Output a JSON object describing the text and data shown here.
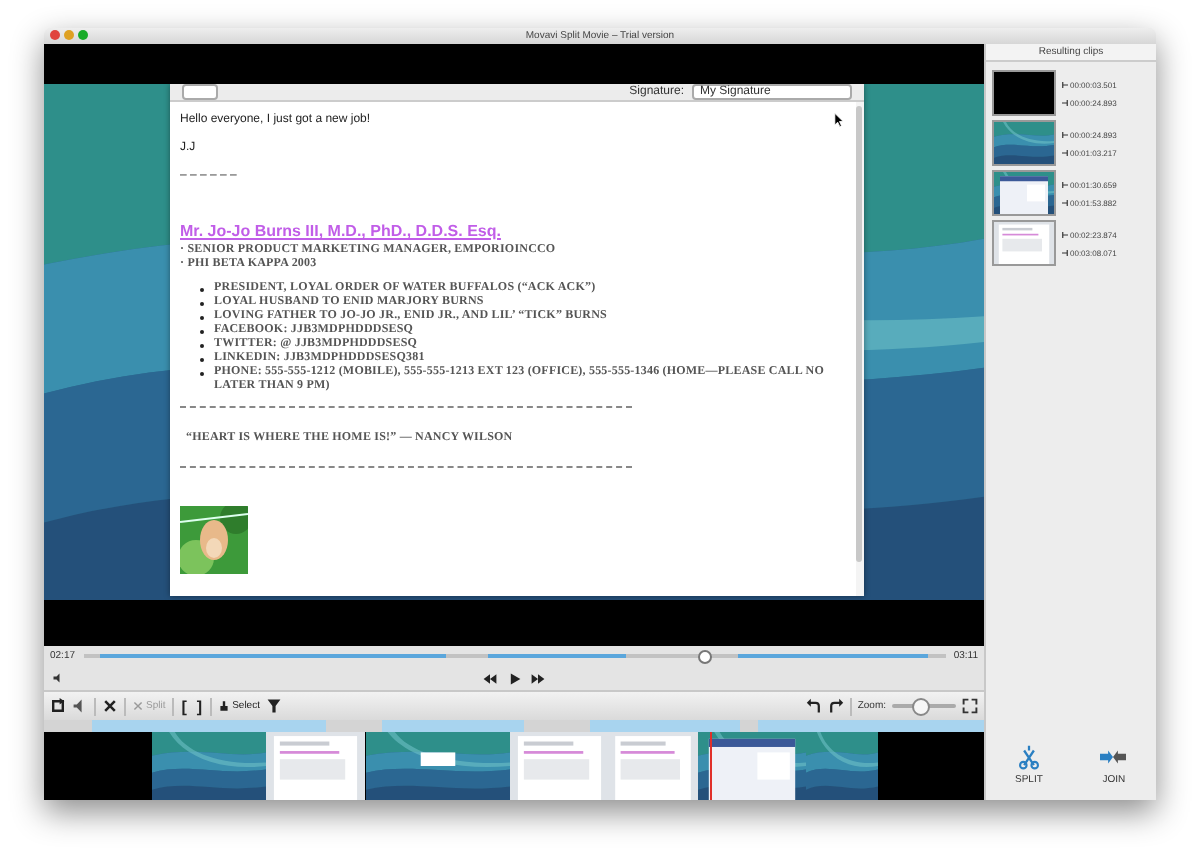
{
  "window": {
    "title": "Movavi Split Movie – Trial version"
  },
  "email": {
    "signature_label": "Signature:",
    "signature_value": "My Signature",
    "greeting": "Hello everyone, I just got a new job!",
    "sign_off": "J.J",
    "separator": "– – – – – –",
    "heading": "Mr. Jo-Jo Burns III, M.D., PhD., D.D.S. Esq.",
    "details": [
      "· SENIOR PRODUCT MARKETING MANAGER, EMPORIOINCCO",
      "· PHI BETA KAPPA 2003"
    ],
    "bullets": [
      "PRESIDENT, LOYAL ORDER OF WATER BUFFALOS (“ACK ACK”)",
      "LOYAL HUSBAND TO ENID MARJORY BURNS",
      "LOVING FATHER TO JO-JO JR., ENID JR., AND LIL’ “TICK” BURNS",
      "FACEBOOK: JJB3MDPHDDDSESQ",
      "TWITTER: @ JJB3MDPHDDDSESQ",
      "LINKEDIN: JJB3MDPHDDDSESQ381",
      "PHONE: 555-555-1212 (MOBILE), 555-555-1213 EXT 123 (OFFICE), 555-555-1346 (HOME—PLEASE CALL NO LATER THAN 9 PM)"
    ],
    "quote": "“HEART IS WHERE THE HOME IS!” — NANCY WILSON"
  },
  "player": {
    "elapsed": "02:17",
    "total": "03:11",
    "level": 0.72
  },
  "toolbar": {
    "split": {
      "label": "Split",
      "disabled": true
    },
    "mark_in": "[",
    "mark_out": "]",
    "select": "Select",
    "zoom": {
      "label": "Zoom:",
      "level": 0.45
    }
  },
  "clips": {
    "title": "Resulting clips",
    "items": [
      {
        "kind": "black",
        "start": "00:00:03.501",
        "end": "00:00:24.893"
      },
      {
        "kind": "wallpaper",
        "start": "00:00:24.893",
        "end": "00:01:03.217"
      },
      {
        "kind": "screen",
        "start": "00:01:30.659",
        "end": "00:01:53.882"
      },
      {
        "kind": "page",
        "start": "00:02:23.874",
        "end": "00:03:08.071"
      }
    ]
  },
  "actions": [
    {
      "kind": "split",
      "label": "SPLIT"
    },
    {
      "kind": "join",
      "label": "JOIN"
    }
  ]
}
